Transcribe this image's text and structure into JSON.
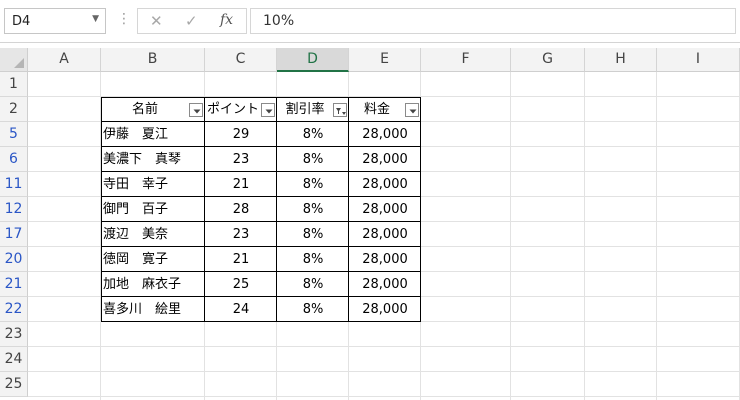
{
  "formula_bar": {
    "name_box": "D4",
    "formula": "10%"
  },
  "columns": [
    "A",
    "B",
    "C",
    "D",
    "E",
    "F",
    "G",
    "H",
    "I"
  ],
  "selected_column": "D",
  "rows": [
    {
      "num": "1",
      "filtered": false
    },
    {
      "num": "2",
      "filtered": false
    },
    {
      "num": "5",
      "filtered": true
    },
    {
      "num": "6",
      "filtered": true
    },
    {
      "num": "11",
      "filtered": true
    },
    {
      "num": "12",
      "filtered": true
    },
    {
      "num": "17",
      "filtered": true
    },
    {
      "num": "20",
      "filtered": true
    },
    {
      "num": "21",
      "filtered": true
    },
    {
      "num": "22",
      "filtered": true
    },
    {
      "num": "23",
      "filtered": false
    },
    {
      "num": "24",
      "filtered": false
    },
    {
      "num": "25",
      "filtered": false
    }
  ],
  "table": {
    "headers": [
      "名前",
      "ポイント",
      "割引率",
      "料金"
    ],
    "header_filter_active": [
      false,
      false,
      true,
      false
    ],
    "data": [
      [
        "伊藤　夏江",
        "29",
        "8%",
        "28,000"
      ],
      [
        "美濃下　真琴",
        "23",
        "8%",
        "28,000"
      ],
      [
        "寺田　幸子",
        "21",
        "8%",
        "28,000"
      ],
      [
        "御門　百子",
        "28",
        "8%",
        "28,000"
      ],
      [
        "渡辺　美奈",
        "23",
        "8%",
        "28,000"
      ],
      [
        "徳岡　寛子",
        "21",
        "8%",
        "28,000"
      ],
      [
        "加地　麻衣子",
        "25",
        "8%",
        "28,000"
      ],
      [
        "喜多川　絵里",
        "24",
        "8%",
        "28,000"
      ]
    ]
  },
  "colors": {
    "selected_header_accent": "#217346",
    "filtered_row_number": "#2a56c6"
  }
}
